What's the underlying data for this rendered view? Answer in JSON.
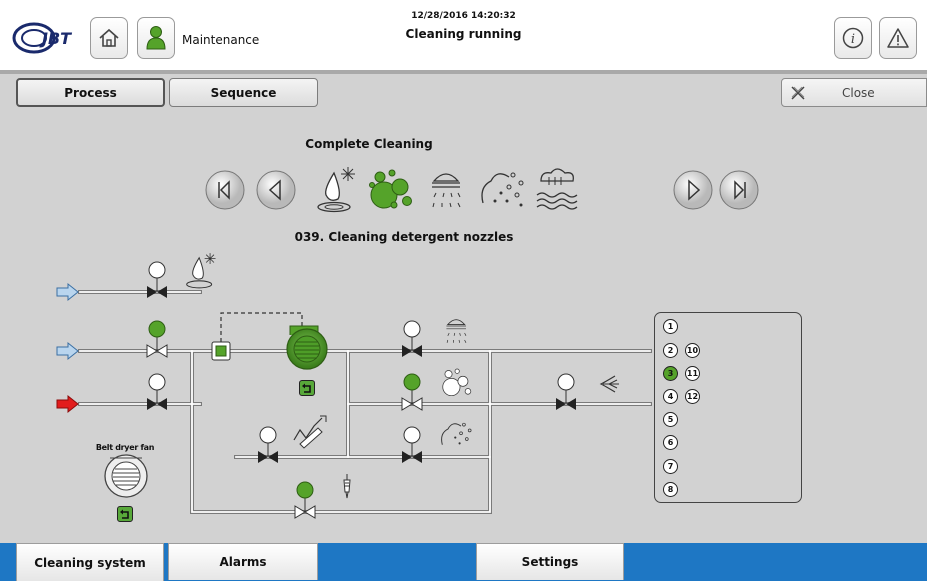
{
  "header": {
    "logo_text": "JBT",
    "user_label": "Maintenance",
    "datetime": "12/28/2016 14:20:32",
    "status": "Cleaning running"
  },
  "tabs": {
    "process": "Process",
    "sequence": "Sequence",
    "close": "Close"
  },
  "cleaning": {
    "title": "Complete Cleaning",
    "current_step": "039. Cleaning detergent nozzles",
    "program_icons": [
      "water-drop-sparkle-icon",
      "detergent-bubbles-icon",
      "shower-nozzle-icon",
      "foam-spray-icon",
      "steam-waves-icon"
    ],
    "active_program_icon": "detergent-bubbles-icon"
  },
  "diagram": {
    "belt_dryer_label": "Belt dryer fan",
    "inlet_colors": {
      "water": "#b9d5ee",
      "hot": "#e21c1c"
    },
    "active_color": "#55a32a"
  },
  "circuits": {
    "left": [
      "1",
      "2",
      "3",
      "4",
      "5",
      "6",
      "7",
      "8"
    ],
    "right": [
      "10",
      "11",
      "12"
    ],
    "active": "3"
  },
  "bottom_tabs": {
    "cleaning_system": "Cleaning system",
    "alarms": "Alarms",
    "settings": "Settings"
  }
}
